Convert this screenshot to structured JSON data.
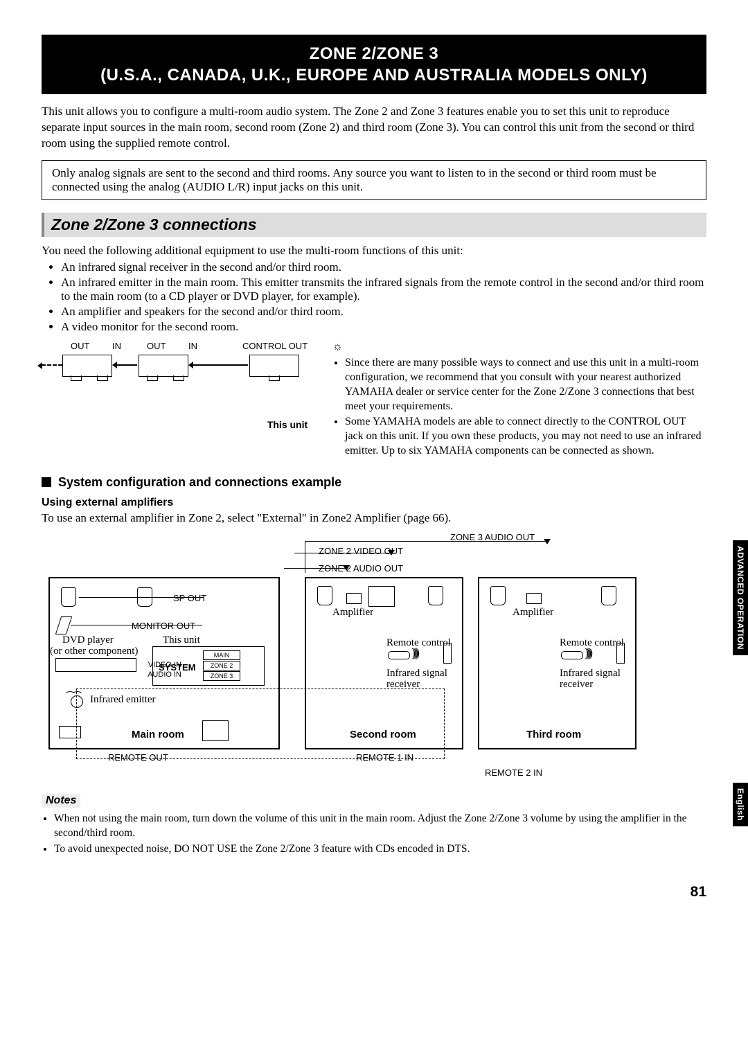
{
  "title": {
    "line1": "ZONE 2/ZONE 3",
    "line2": "(U.S.A., CANADA, U.K., EUROPE AND AUSTRALIA MODELS ONLY)"
  },
  "intro": "This unit allows you to configure a multi-room audio system. The Zone 2 and Zone 3 features enable you to set this unit to reproduce separate input sources in the main room, second room (Zone 2) and third room (Zone 3). You can control this unit from the second or third room using the supplied remote control.",
  "infoBox": "Only analog signals are sent to the second and third rooms. Any source you want to listen to in the second or third room must be connected using the analog (AUDIO L/R) input jacks on this unit.",
  "section1": {
    "heading": "Zone 2/Zone 3 connections",
    "intro": "You need the following additional equipment to use the multi-room functions of this unit:",
    "bullets": [
      "An infrared signal receiver in the second and/or third room.",
      "An infrared emitter in the main room. This emitter transmits the infrared signals from the remote control in the second and/or third room to the main room (to a CD player or DVD player, for example).",
      "An amplifier and speakers for the second and/or third room.",
      "A video monitor for the second room."
    ]
  },
  "diagram1": {
    "labels": {
      "out": "OUT",
      "in": "IN",
      "controlOut": "CONTROL OUT"
    },
    "thisUnit": "This unit"
  },
  "tipIconText": "☼",
  "tips": [
    "Since there are many possible ways to connect and use this unit in a multi-room configuration, we recommend that you consult with your nearest authorized YAMAHA dealer or service center for the Zone 2/Zone 3 connections that best meet your requirements.",
    "Some YAMAHA models are able to connect directly to the CONTROL OUT jack on this unit. If you own these products, you may not need to use an infrared emitter. Up to six YAMAHA components can be connected as shown."
  ],
  "configExample": {
    "heading": "System configuration and connections example",
    "sub": "Using external amplifiers",
    "text": "To use an external amplifier in Zone 2, select \"External\" in Zone2 Amplifier (page 66)."
  },
  "diagram2": {
    "zone3AudioOut": "ZONE 3 AUDIO OUT",
    "zone2VideoOut": "ZONE 2 VIDEO OUT",
    "zone2AudioOut": "ZONE 2 AUDIO OUT",
    "spOut": "SP OUT",
    "monitorOut": "MONITOR OUT",
    "dvdPlayer": "DVD player",
    "orOther": "(or other component)",
    "thisUnit": "This unit",
    "system": "SYSTEM",
    "main": "MAIN",
    "zone2": "ZONE 2",
    "zone3": "ZONE 3",
    "videoIn": "VIDEO IN",
    "audioIn": "AUDIO IN",
    "infraredEmitter": "Infrared emitter",
    "mainRoom": "Main room",
    "amplifier": "Amplifier",
    "remoteControl": "Remote control",
    "infraredSignalReceiver": "Infrared signal",
    "receiver": "receiver",
    "secondRoom": "Second room",
    "thirdRoom": "Third room",
    "remoteOut": "REMOTE OUT",
    "remote1In": "REMOTE 1 IN",
    "remote2In": "REMOTE 2 IN"
  },
  "notes": {
    "label": "Notes",
    "items": [
      "When not using the main room, turn down the volume of this unit in the main room. Adjust the Zone 2/Zone 3 volume by using the amplifier in the second/third room.",
      "To avoid unexpected noise, DO NOT USE the Zone 2/Zone 3 feature with CDs encoded in DTS."
    ]
  },
  "sideTabs": {
    "advanced": "ADVANCED OPERATION",
    "english": "English"
  },
  "pageNumber": "81"
}
